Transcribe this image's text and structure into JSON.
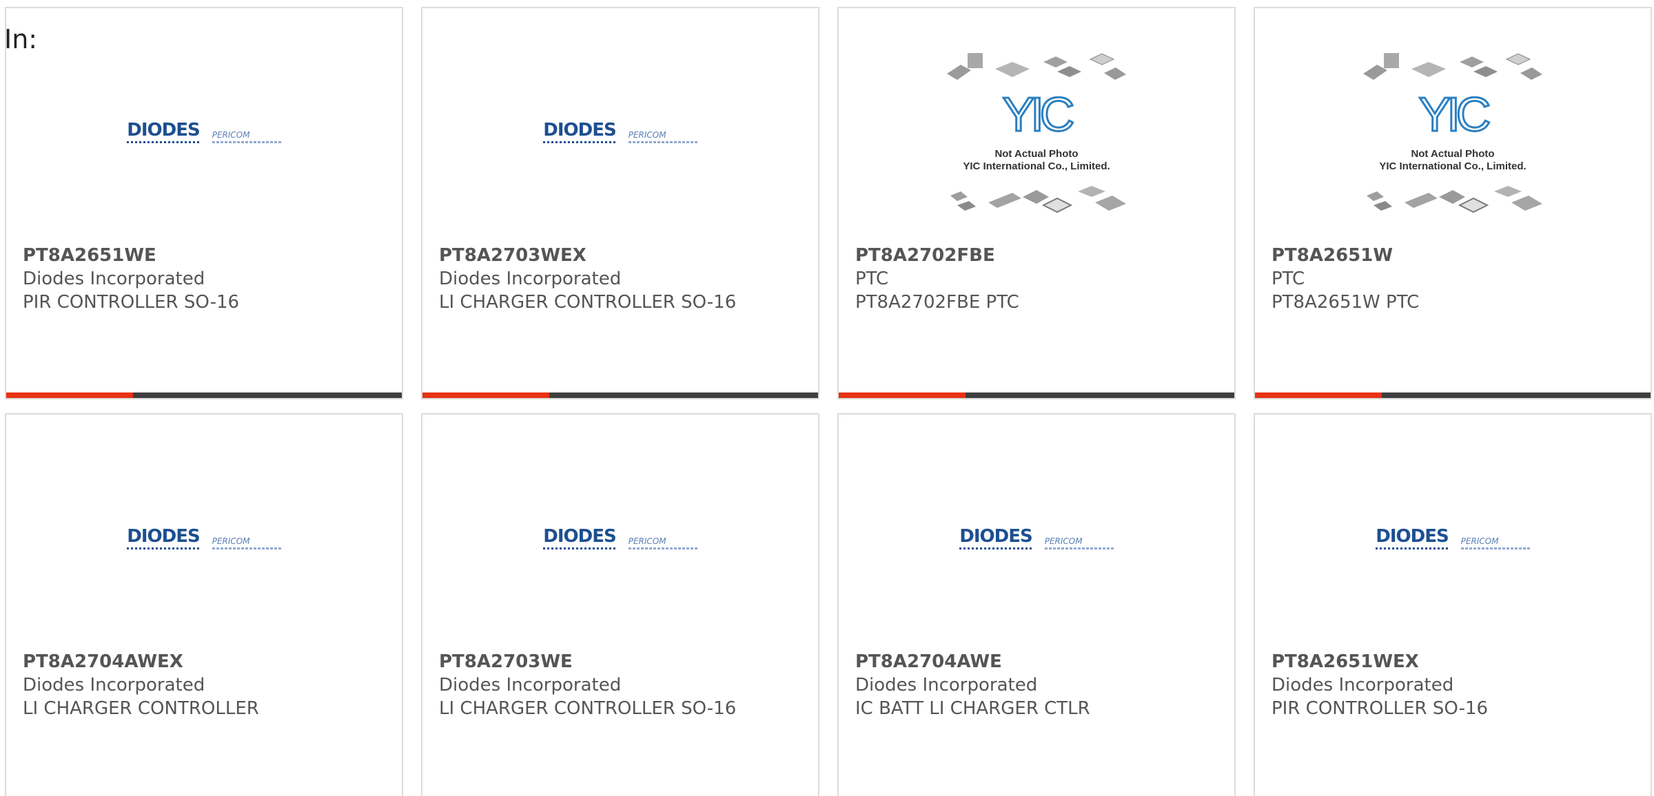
{
  "header": {
    "in_label": "In:"
  },
  "brand": {
    "diodes": "DIODES",
    "pericom": "PERICOM",
    "yic_logo": "YIC",
    "yic_line1": "Not Actual Photo",
    "yic_line2": "YIC International Co., Limited."
  },
  "colors": {
    "accent": "#e63312",
    "bar": "#3f3f3f",
    "text": "#555555",
    "border": "#dcdcdc"
  },
  "products": [
    {
      "part": "PT8A2651WE",
      "manufacturer": "Diodes Incorporated",
      "description": "PIR CONTROLLER SO-16",
      "image": "diodes-logo"
    },
    {
      "part": "PT8A2703WEX",
      "manufacturer": "Diodes Incorporated",
      "description": "LI CHARGER CONTROLLER SO-16",
      "image": "diodes-logo"
    },
    {
      "part": "PT8A2702FBE",
      "manufacturer": "PTC",
      "description": "PT8A2702FBE PTC",
      "image": "yic-placeholder"
    },
    {
      "part": "PT8A2651W",
      "manufacturer": "PTC",
      "description": "PT8A2651W PTC",
      "image": "yic-placeholder"
    },
    {
      "part": "PT8A2704AWEX",
      "manufacturer": "Diodes Incorporated",
      "description": "LI CHARGER CONTROLLER",
      "image": "diodes-logo"
    },
    {
      "part": "PT8A2703WE",
      "manufacturer": "Diodes Incorporated",
      "description": "LI CHARGER CONTROLLER SO-16",
      "image": "diodes-logo"
    },
    {
      "part": "PT8A2704AWE",
      "manufacturer": "Diodes Incorporated",
      "description": "IC BATT LI CHARGER CTLR",
      "image": "diodes-logo"
    },
    {
      "part": "PT8A2651WEX",
      "manufacturer": "Diodes Incorporated",
      "description": "PIR CONTROLLER SO-16",
      "image": "diodes-logo"
    }
  ]
}
